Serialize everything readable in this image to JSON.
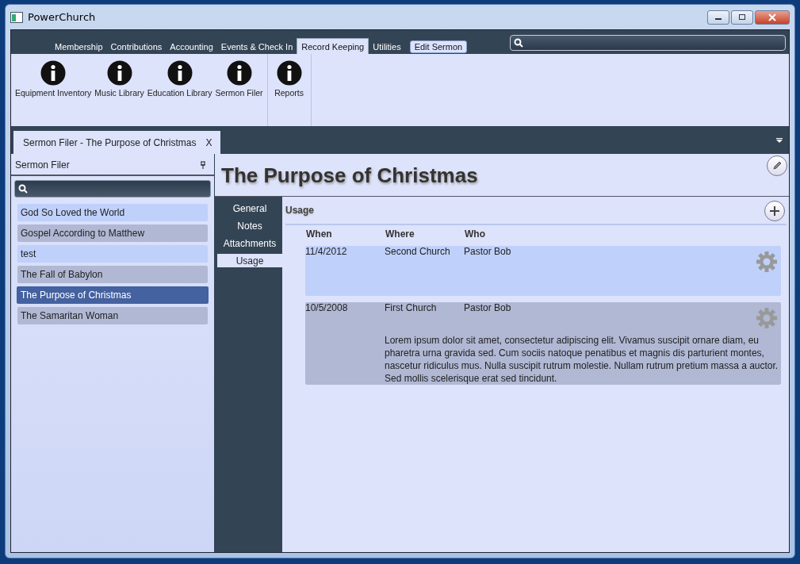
{
  "window": {
    "title": "PowerChurch"
  },
  "menu_tabs": [
    {
      "label": "Membership",
      "selected": false
    },
    {
      "label": "Contributions",
      "selected": false
    },
    {
      "label": "Accounting",
      "selected": false
    },
    {
      "label": "Events & Check In",
      "selected": false
    },
    {
      "label": "Record Keeping",
      "selected": true
    },
    {
      "label": "Utilities",
      "selected": false
    }
  ],
  "context_button": "Edit Sermon",
  "ribbon_groups": [
    {
      "items": [
        "Equipment Inventory",
        "Music Library",
        "Education Library",
        "Sermon Filer"
      ]
    },
    {
      "items": [
        "Reports"
      ]
    }
  ],
  "document_tab": {
    "label": "Sermon Filer - The Purpose of Christmas",
    "close": "X"
  },
  "sidebar": {
    "title": "Sermon Filer",
    "items": [
      {
        "label": "God So Loved the World",
        "selected": false
      },
      {
        "label": "Gospel According to Matthew",
        "selected": false
      },
      {
        "label": "test",
        "selected": false
      },
      {
        "label": "The Fall of Babylon",
        "selected": false
      },
      {
        "label": "The Purpose of Christmas",
        "selected": true
      },
      {
        "label": "The Samaritan Woman",
        "selected": false
      }
    ]
  },
  "detail": {
    "title": "The Purpose of Christmas",
    "sections": [
      {
        "label": "General",
        "selected": false
      },
      {
        "label": "Notes",
        "selected": false
      },
      {
        "label": "Attachments",
        "selected": false
      },
      {
        "label": "Usage",
        "selected": true
      }
    ],
    "usage": {
      "heading": "Usage",
      "columns": [
        "When",
        "Where",
        "Who"
      ],
      "rows": [
        {
          "when": "11/4/2012",
          "where": "Second Church",
          "who": "Pastor Bob"
        },
        {
          "when": "10/5/2008",
          "where": "First Church",
          "who": "Pastor Bob",
          "notes": "Lorem ipsum dolor sit amet, consectetur adipiscing elit. Vivamus suscipit ornare diam, eu pharetra urna gravida sed. Cum sociis natoque penatibus et magnis dis parturient montes, nascetur ridiculus mus. Nulla suscipit rutrum molestie. Nullam rutrum pretium massa a auctor. Sed mollis scelerisque erat sed tincidunt."
        }
      ]
    }
  }
}
